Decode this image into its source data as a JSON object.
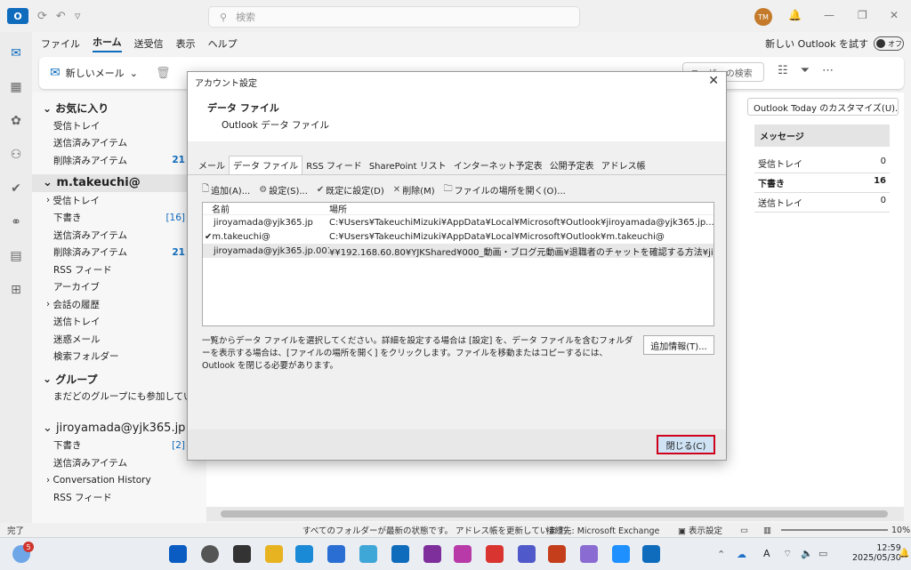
{
  "titlebar": {
    "app_icon": "O",
    "search_placeholder": "検索",
    "avatar": "TM"
  },
  "menu": {
    "file": "ファイル",
    "home": "ホーム",
    "sendrecv": "送受信",
    "view": "表示",
    "help": "ヘルプ"
  },
  "new_outlook": {
    "label": "新しい Outlook を試す",
    "toggle": "オフ"
  },
  "ribbon": {
    "new_mail": "新しいメール",
    "search": "ユーザーの検索"
  },
  "folders": {
    "favorites": "お気に入り",
    "fav_inbox": "受信トレイ",
    "fav_sent": "送信済みアイテム",
    "fav_deleted": "削除済みアイテム",
    "fav_deleted_count": "21",
    "account1": "m.takeuchi@",
    "inbox": "受信トレイ",
    "drafts": "下書き",
    "drafts_count": "[16]",
    "sent": "送信済みアイテム",
    "deleted": "削除済みアイテム",
    "deleted_count": "21",
    "rss": "RSS フィード",
    "archive": "アーカイブ",
    "conv_history": "会話の履歴",
    "outbox": "送信トレイ",
    "junk": "迷惑メール",
    "search_folders": "検索フォルダー",
    "groups": "グループ",
    "groups_msg": "まだどのグループにも参加してい…",
    "account2": "jiroyamada@yjk365.jp",
    "a2_drafts": "下書き",
    "a2_drafts_count": "[2]",
    "a2_sent": "送信済みアイテム",
    "a2_conv": "Conversation History",
    "a2_rss": "RSS フィード"
  },
  "right_pane": {
    "customize": "Outlook Today のカスタマイズ(U)...",
    "messages": "メッセージ",
    "rows": [
      {
        "name": "受信トレイ",
        "count": "0"
      },
      {
        "name": "下書き",
        "count": "16"
      },
      {
        "name": "送信トレイ",
        "count": "0"
      }
    ]
  },
  "dialog": {
    "title": "アカウント設定",
    "heading": "データ ファイル",
    "subheading": "Outlook データ ファイル",
    "tabs": [
      "メール",
      "データ ファイル",
      "RSS フィード",
      "SharePoint リスト",
      "インターネット予定表",
      "公開予定表",
      "アドレス帳"
    ],
    "toolbar": {
      "add": "追加(A)...",
      "settings": "設定(S)...",
      "default": "既定に設定(D)",
      "remove": "削除(M)",
      "open_location": "ファイルの場所を開く(O)..."
    },
    "columns": {
      "name": "名前",
      "location": "場所"
    },
    "rows": [
      {
        "name": "jiroyamada@yjk365.jp",
        "location": "C:¥Users¥TakeuchiMizuki¥AppData¥Local¥Microsoft¥Outlook¥jiroyamada@yjk365.jp...."
      },
      {
        "name": "m.takeuchi@",
        "location": "C:¥Users¥TakeuchiMizuki¥AppData¥Local¥Microsoft¥Outlook¥m.takeuchi@"
      },
      {
        "name": "jiroyamada@yjk365.jp.001",
        "location": "¥¥192.168.60.80¥YJKShared¥000_動画・ブログ元動画¥退職者のチャットを確認する方法¥jiroya..."
      }
    ],
    "help_text": "一覧からデータ ファイルを選択してください。詳細を設定する場合は [設定] を、データ ファイルを含むフォルダーを表示する場合は、[ファイルの場所を開く] をクリックします。ファイルを移動またはコピーするには、Outlook を閉じる必要があります。",
    "more_info": "追加情報(T)...",
    "close": "閉じる(C)"
  },
  "status": {
    "left": "完了",
    "center": "すべてのフォルダーが最新の状態です。 アドレス帳を更新しています。",
    "connection": "接続先: Microsoft Exchange",
    "view_settings": "表示設定",
    "zoom": "10%"
  },
  "taskbar": {
    "badge": "5",
    "time": "12:59",
    "date": "2025/05/30"
  }
}
